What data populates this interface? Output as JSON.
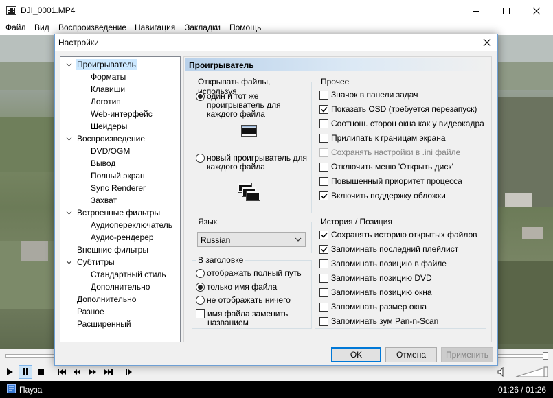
{
  "window": {
    "title": "DJI_0001.MP4"
  },
  "menu": [
    "Файл",
    "Вид",
    "Воспроизведение",
    "Навигация",
    "Закладки",
    "Помощь"
  ],
  "status": {
    "text": "Пауза",
    "time": "01:26 / 01:26"
  },
  "dialog": {
    "title": "Настройки",
    "panel_title": "Проигрыватель",
    "tree": [
      {
        "label": "Проигрыватель",
        "level": 0,
        "expanded": true,
        "selected": true
      },
      {
        "label": "Форматы",
        "level": 1
      },
      {
        "label": "Клавиши",
        "level": 1
      },
      {
        "label": "Логотип",
        "level": 1
      },
      {
        "label": "Web-интерфейс",
        "level": 1
      },
      {
        "label": "Шейдеры",
        "level": 1
      },
      {
        "label": "Воспроизведение",
        "level": 0,
        "expanded": true
      },
      {
        "label": "DVD/OGM",
        "level": 1
      },
      {
        "label": "Вывод",
        "level": 1
      },
      {
        "label": "Полный экран",
        "level": 1
      },
      {
        "label": "Sync Renderer",
        "level": 1
      },
      {
        "label": "Захват",
        "level": 1
      },
      {
        "label": "Встроенные фильтры",
        "level": 0,
        "expanded": true
      },
      {
        "label": "Аудиопереключатель",
        "level": 1
      },
      {
        "label": "Аудио-рендерер",
        "level": 1
      },
      {
        "label": "Внешние фильтры",
        "level": 0
      },
      {
        "label": "Субтитры",
        "level": 0,
        "expanded": true
      },
      {
        "label": "Стандартный стиль",
        "level": 1
      },
      {
        "label": "Дополнительно",
        "level": 1
      },
      {
        "label": "Дополнительно",
        "level": 0
      },
      {
        "label": "Разное",
        "level": 0
      },
      {
        "label": "Расширенный",
        "level": 0
      }
    ],
    "open_files": {
      "title": "Открывать файлы, используя",
      "option_same": "один и тот же проигрыватель для каждого файла",
      "option_new": "новый проигрыватель для каждого файла",
      "selected": "same"
    },
    "language": {
      "title": "Язык",
      "value": "Russian"
    },
    "caption": {
      "title": "В заголовке",
      "options": [
        "отображать полный путь",
        "только имя файла",
        "не отображать ничего"
      ],
      "selected_index": 1,
      "replace_label": "имя файла заменить названием",
      "replace_checked": false
    },
    "misc": {
      "title": "Прочее",
      "items": [
        {
          "label": "Значок в панели задач",
          "checked": false
        },
        {
          "label": "Показать OSD (требуется перезапуск)",
          "checked": true
        },
        {
          "label": "Соотнош. сторон окна как у видеокадра",
          "checked": false
        },
        {
          "label": "Прилипать к границам экрана",
          "checked": false
        },
        {
          "label": "Сохранять настройки в .ini файле",
          "checked": false,
          "disabled": true
        },
        {
          "label": "Отключить меню 'Открыть диск'",
          "checked": false
        },
        {
          "label": "Повышенный приоритет процесса",
          "checked": false
        },
        {
          "label": "Включить поддержку обложки",
          "checked": true
        }
      ]
    },
    "history": {
      "title": "История / Позиция",
      "items": [
        {
          "label": "Сохранять историю открытых файлов",
          "checked": true
        },
        {
          "label": "Запоминать последний плейлист",
          "checked": true
        },
        {
          "label": "Запоминать позицию в файле",
          "checked": false
        },
        {
          "label": "Запоминать позицию DVD",
          "checked": false
        },
        {
          "label": "Запоминать позицию окна",
          "checked": false
        },
        {
          "label": "Запоминать размер окна",
          "checked": false
        },
        {
          "label": "Запоминать зум Pan-n-Scan",
          "checked": false
        }
      ]
    },
    "buttons": {
      "ok": "OK",
      "cancel": "Отмена",
      "apply": "Применить"
    }
  },
  "colors": {
    "selection": "#cce8ff",
    "accent": "#0078d7",
    "header_gradient": "#b9d1ea"
  }
}
